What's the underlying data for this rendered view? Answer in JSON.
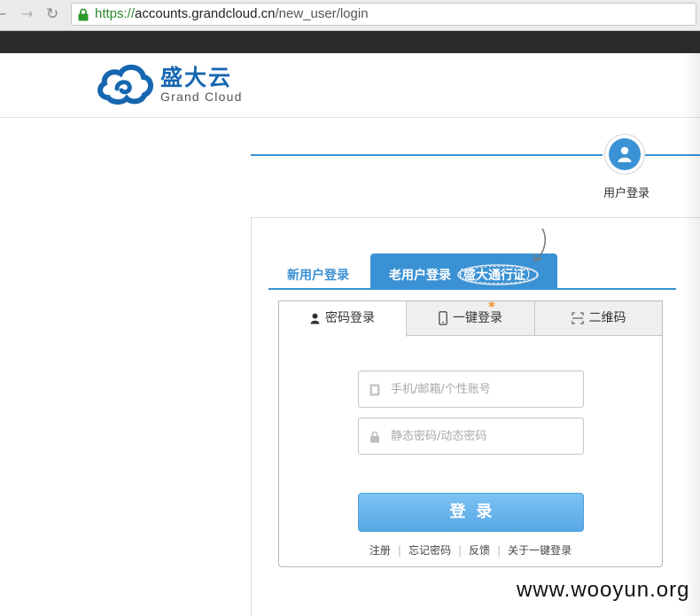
{
  "browser": {
    "url_scheme": "https://",
    "url_host": "accounts.grandcloud.cn",
    "url_path": "/new_user/login",
    "back_icon": "arrow-left-icon",
    "forward_icon": "arrow-right-icon",
    "reload_icon": "reload-icon",
    "secure_icon": "lock-icon"
  },
  "header": {
    "logo_cn": "盛大云",
    "logo_en": "Grand Cloud",
    "logo_icon": "cloud-logo-icon",
    "brand_color": "#1767b0"
  },
  "progress": {
    "step_label": "用户登录",
    "step_icon": "user-icon",
    "accent": "#3a92d4"
  },
  "tabs": {
    "new_user": "新用户登录",
    "existing_user": "老用户登录",
    "existing_user_paren_open": "（",
    "existing_user_pass": "盛大通行证",
    "existing_user_paren_close": "）"
  },
  "subtabs": {
    "password": "密码登录",
    "onekey": "一键登录",
    "qrcode": "二维码",
    "password_icon": "user-icon",
    "onekey_icon": "phone-icon",
    "qrcode_icon": "qr-scan-icon",
    "new_badge": "*"
  },
  "form": {
    "username_placeholder": "手机/邮箱/个性账号",
    "username_value": "",
    "password_placeholder": "静态密码/动态密码",
    "password_value": "",
    "username_icon": "id-card-icon",
    "password_icon": "lock-icon",
    "submit_label": "登录"
  },
  "links": {
    "register": "注册",
    "forgot_password": "忘记密码",
    "feedback": "反馈",
    "about_onekey": "关于一键登录",
    "separator": "|"
  },
  "watermark": "www.wooyun.org"
}
